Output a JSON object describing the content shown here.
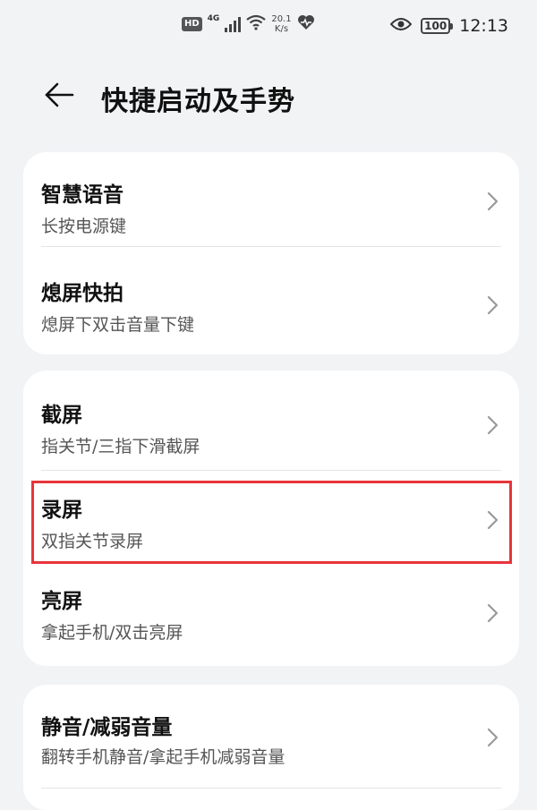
{
  "status_bar": {
    "hd_label": "HD",
    "network_label": "4G",
    "speed_value": "20.1",
    "speed_unit": "K/s",
    "battery_level": "100",
    "time": "12:13",
    "icons": [
      "hd-icon",
      "signal-icon",
      "wifi-icon",
      "heart-rate-icon",
      "eye-icon",
      "battery-icon"
    ]
  },
  "header": {
    "back_icon": "arrow-left-icon",
    "title": "快捷启动及手势"
  },
  "groups": [
    {
      "items": [
        {
          "title": "智慧语音",
          "subtitle": "长按电源键"
        },
        {
          "title": "熄屏快拍",
          "subtitle": "熄屏下双击音量下键"
        }
      ]
    },
    {
      "items": [
        {
          "title": "截屏",
          "subtitle": "指关节/三指下滑截屏"
        },
        {
          "title": "录屏",
          "subtitle": "双指关节录屏"
        },
        {
          "title": "亮屏",
          "subtitle": "拿起手机/双击亮屏"
        }
      ]
    },
    {
      "items": [
        {
          "title": "静音/减弱音量",
          "subtitle": "翻转手机静音/拿起手机减弱音量"
        }
      ]
    }
  ],
  "colors": {
    "background": "#f1f3f5",
    "card": "#ffffff",
    "highlight": "#e8353a"
  }
}
